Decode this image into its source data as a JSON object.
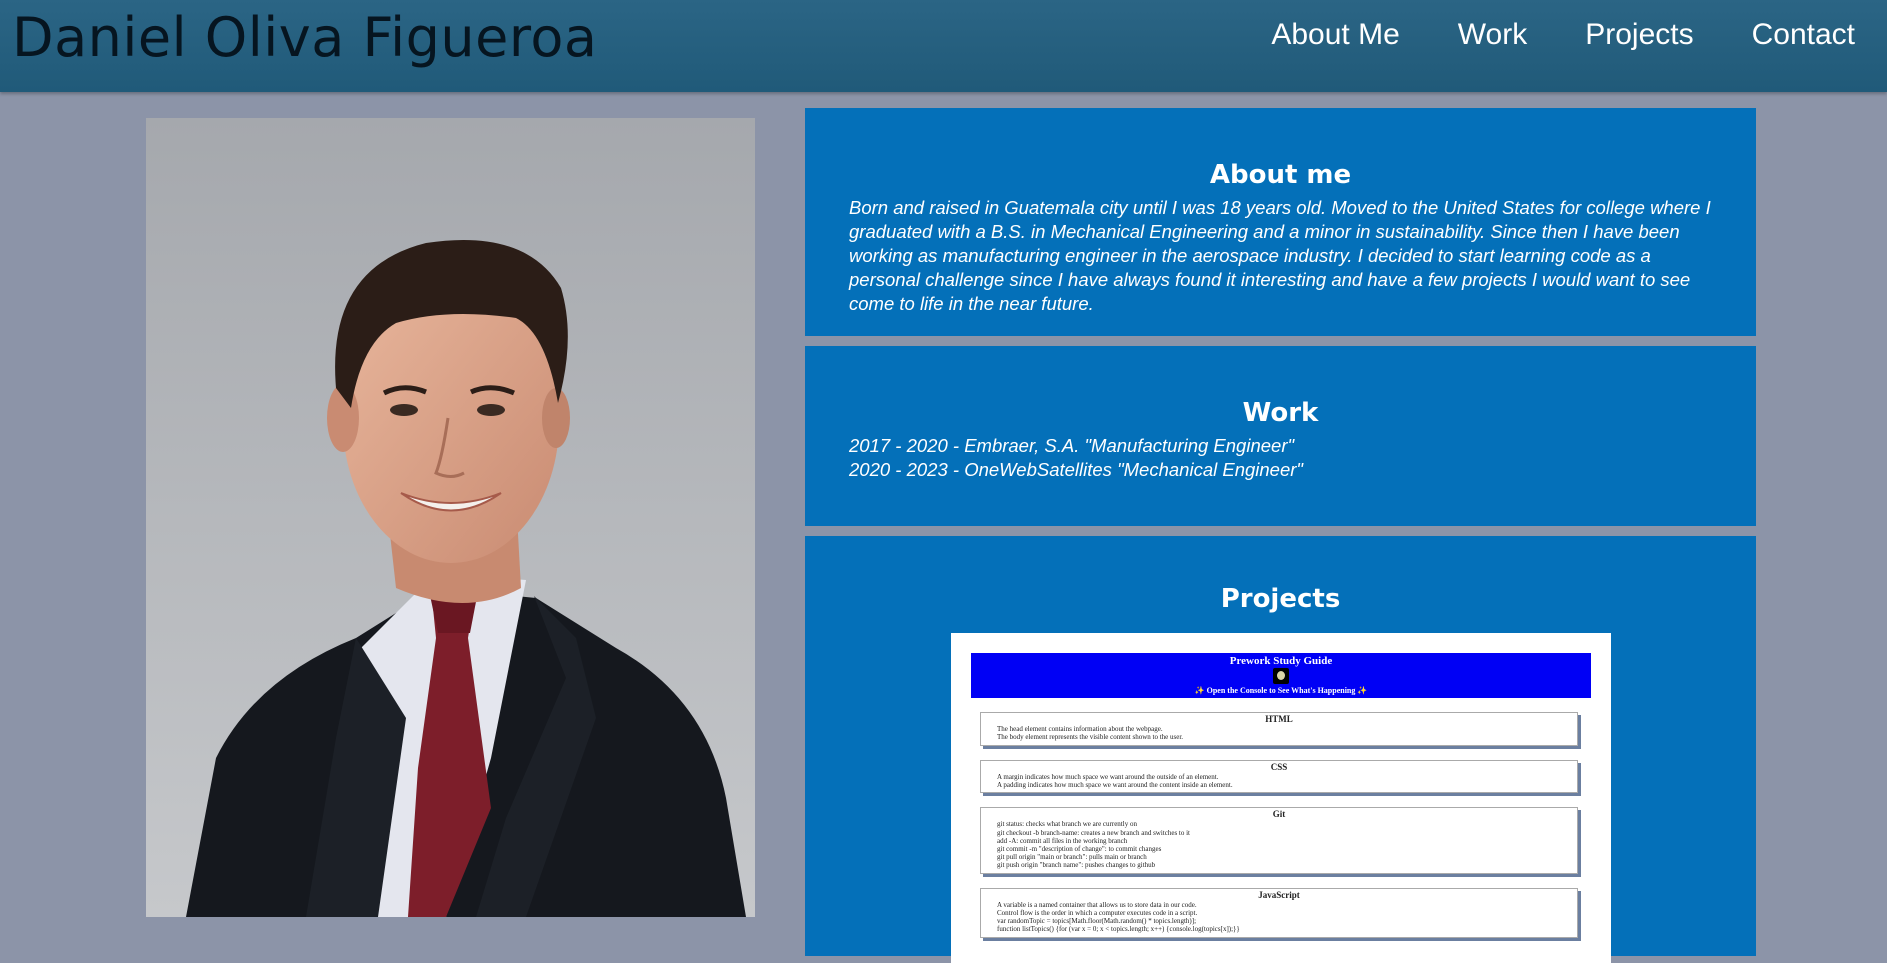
{
  "header": {
    "title": "Daniel Oliva Figueroa",
    "nav": [
      "About Me",
      "Work",
      "Projects",
      "Contact"
    ]
  },
  "about": {
    "heading": "About me",
    "text": "Born and raised in Guatemala city until I was 18 years old. Moved to the United States for college where I graduated with a B.S. in Mechanical Engineering and a minor in sustainability. Since then I have been working as manufacturing engineer in the aerospace industry. I decided to start learning code as a personal challenge since I have always found it interesting and have a few projects I would want to see come to life in the near future."
  },
  "work": {
    "heading": "Work",
    "items": [
      "2017 - 2020 - Embraer, S.A. \"Manufacturing Engineer\"",
      "2020 - 2023 - OneWebSatellites \"Mechanical Engineer\""
    ]
  },
  "projects": {
    "heading": "Projects",
    "preview": {
      "title": "Prework Study Guide",
      "console_note": "✨ Open the Console to See What's Happening ✨",
      "sections": [
        {
          "heading": "HTML",
          "items": [
            "The head element contains information about the webpage.",
            "The body element represents the visible content shown to the user."
          ]
        },
        {
          "heading": "CSS",
          "items": [
            "A margin indicates how much space we want around the outside of an element.",
            "A padding indicates how much space we want around the content inside an element."
          ]
        },
        {
          "heading": "Git",
          "items": [
            "git status: checks what branch we are currently on",
            "git checkout -b branch-name: creates a new branch and switches to it",
            "add -A: commit all files in the working branch",
            "git commit -m \"description of change\": to commit changes",
            "git pull origin \"main or branch\": pulls main or branch",
            "git push origin \"branch name\": pushes changes to github"
          ]
        },
        {
          "heading": "JavaScript",
          "items": [
            "A variable is a named container that allows us to store data in our code.",
            "Control flow is the order in which a computer executes code in a script.",
            "var randomTopic = topics[Math.floor(Math.random() * topics.length)];",
            "function listTopics() {for (var x = 0; x < topics.length; x++) {console.log(topics[x]);}}"
          ]
        }
      ]
    }
  },
  "colors": {
    "page_background": "#8c94a8",
    "header": "#2b6585",
    "card": "#0470b9",
    "preview_banner": "#0000f5"
  },
  "icons": {
    "portrait": "profile-photo",
    "preview_logo": "avatar-logo-icon"
  }
}
